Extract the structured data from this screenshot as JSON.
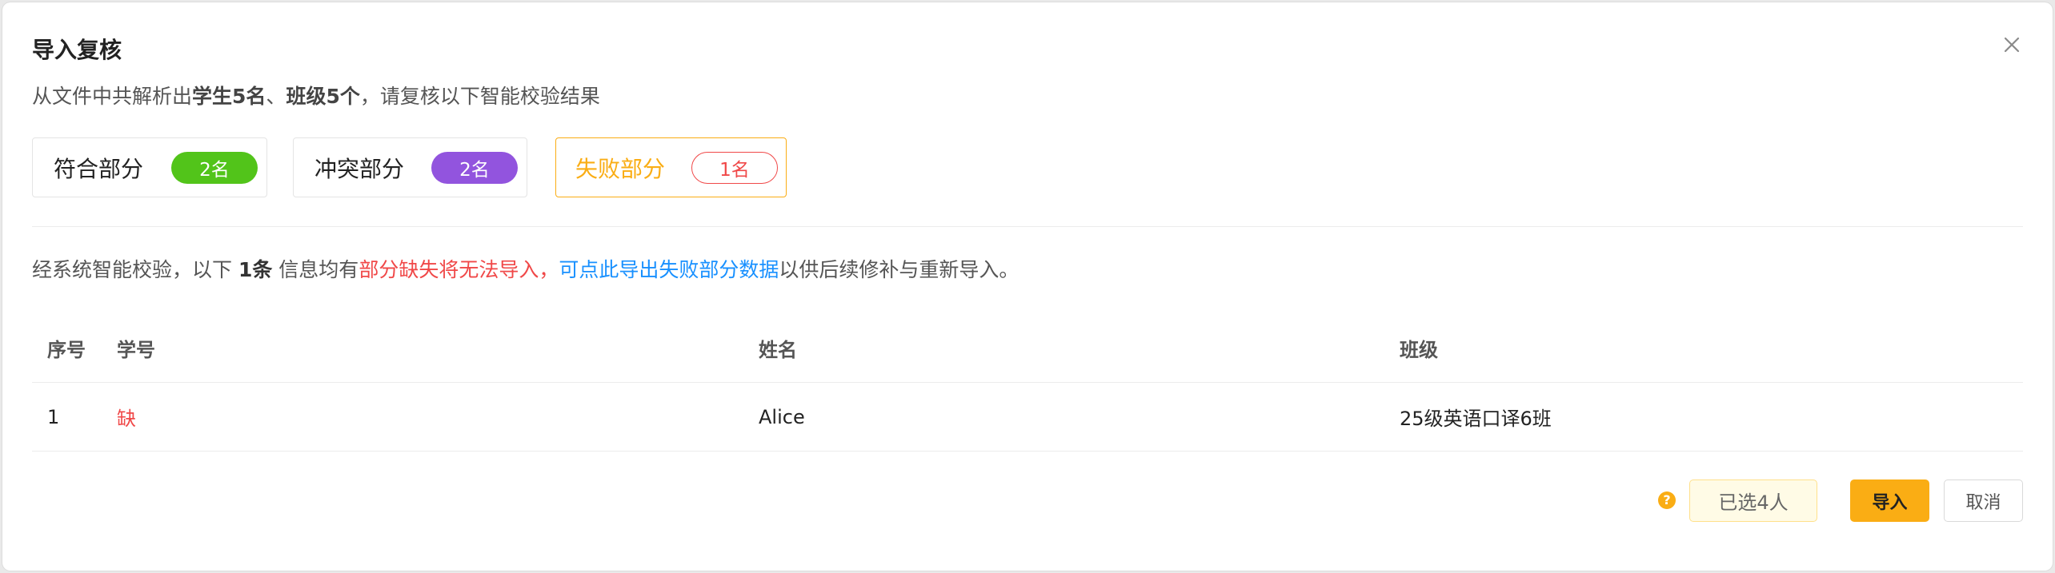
{
  "dialog": {
    "title": "导入复核",
    "close_icon": "close-icon",
    "subtitle": {
      "prefix": "从文件中共解析出",
      "students": "学生5名",
      "sep": "、",
      "classes": "班级5个",
      "suffix": "，请复核以下智能校验结果"
    }
  },
  "tabs": [
    {
      "label": "符合部分",
      "count": "2名",
      "color": "#52c41a"
    },
    {
      "label": "冲突部分",
      "count": "2名",
      "color": "#9254de"
    },
    {
      "label": "失败部分",
      "count": "1名",
      "color": "#f04848",
      "active": true
    }
  ],
  "notice": {
    "prefix": "经系统智能校验，以下 ",
    "count": "1条",
    "middle": " 信息均有",
    "warning": "部分缺失将无法导入，",
    "link": "可点此导出失败部分数据",
    "suffix": "以供后续修补与重新导入。"
  },
  "table": {
    "columns": [
      "序号",
      "学号",
      "姓名",
      "班级"
    ],
    "rows": [
      {
        "index": "1",
        "student_id": "缺",
        "name": "Alice",
        "class": "25级英语口译6班"
      }
    ]
  },
  "footer": {
    "help_icon": "question-circle-icon",
    "help_glyph": "?",
    "selected_label": "已选4人",
    "import_label": "导入",
    "cancel_label": "取消"
  },
  "colors": {
    "accent": "#faad14",
    "success": "#52c41a",
    "conflict": "#9254de",
    "error": "#f04848",
    "link": "#1890ff"
  }
}
